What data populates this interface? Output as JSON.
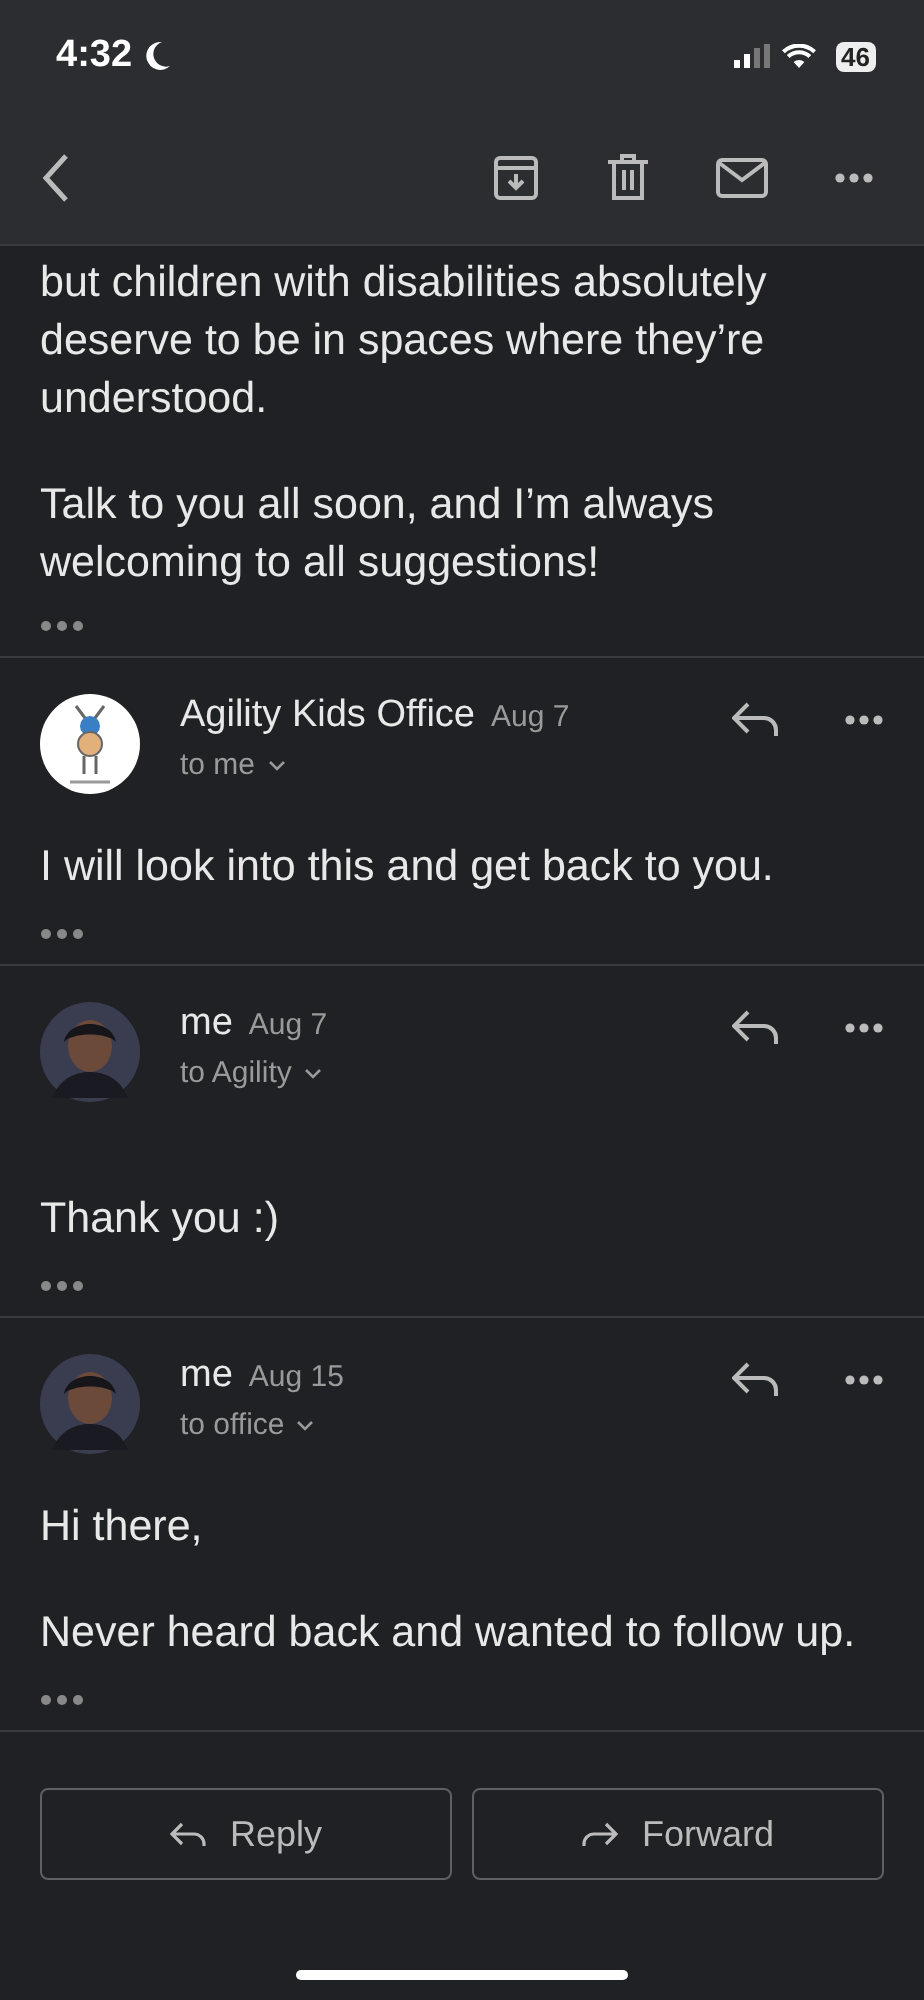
{
  "status_bar": {
    "time": "4:32",
    "battery": "46"
  },
  "earlier_message": {
    "paragraphs": [
      "but children with disabilities absolutely deserve to be in spaces where they’re understood.",
      "Talk to you all soon, and I’m always welcoming to all suggestions!"
    ]
  },
  "messages": [
    {
      "sender": "Agility Kids Office",
      "date": "Aug 7",
      "recipient": "to me",
      "kind": "logo",
      "gap": false,
      "paragraphs": [
        "I will look into this and get back to you."
      ]
    },
    {
      "sender": "me",
      "date": "Aug 7",
      "recipient": "to Agility",
      "kind": "person",
      "gap": true,
      "paragraphs": [
        "Thank you :)"
      ]
    },
    {
      "sender": "me",
      "date": "Aug 15",
      "recipient": "to office",
      "kind": "person",
      "gap": false,
      "paragraphs": [
        "Hi there,",
        "Never heard back and wanted to follow up."
      ]
    }
  ],
  "actions": [
    {
      "label": "Reply",
      "kind": "reply"
    },
    {
      "label": "Forward",
      "kind": "forward"
    }
  ]
}
